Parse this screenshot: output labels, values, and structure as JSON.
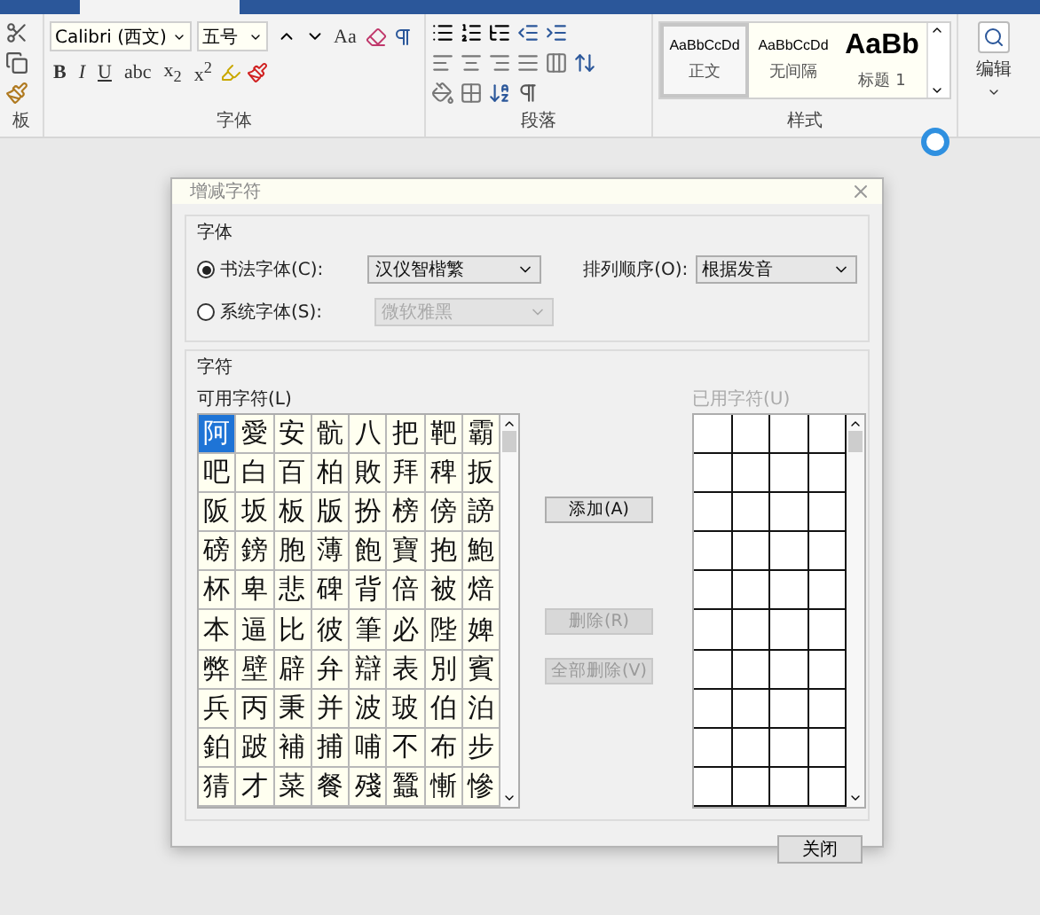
{
  "ribbon": {
    "clipboard_group": {
      "label": "板"
    },
    "font_group": {
      "label": "字体",
      "font_name": "Calibri (西文)",
      "font_size": "五号",
      "case_button": "Aa",
      "format_buttons": [
        "B",
        "I",
        "U",
        "abc",
        "x$_{2}$",
        "x$^{2}$"
      ]
    },
    "paragraph_group": {
      "label": "段落"
    },
    "styles_group": {
      "label": "样式",
      "styles": [
        {
          "sample": "AaBbCcDd",
          "name": "正文",
          "kind": "normal",
          "selected": true
        },
        {
          "sample": "AaBbCcDd",
          "name": "无间隔",
          "kind": "normal",
          "selected": false
        },
        {
          "sample": "AaBb",
          "name": "标题 1",
          "kind": "heading",
          "selected": false
        }
      ]
    },
    "editing_button": {
      "label": "编辑"
    }
  },
  "dialog": {
    "title": "增减字符",
    "font_section": {
      "label": "字体",
      "options": [
        {
          "label": "书法字体(C):",
          "value": "汉仪智楷繁",
          "selected": true,
          "disabled": false
        },
        {
          "label": "系统字体(S):",
          "value": "微软雅黑",
          "selected": false,
          "disabled": true
        }
      ],
      "sort": {
        "label": "排列顺序(O):",
        "value": "根据发音"
      }
    },
    "chars_section": {
      "label": "字符",
      "available": {
        "label": "可用字符(L)",
        "chars": [
          {
            "char": "阿",
            "selected": true
          },
          {
            "char": "愛",
            "selected": false
          },
          {
            "char": "安",
            "selected": false
          },
          {
            "char": "骯",
            "selected": false
          },
          {
            "char": "八",
            "selected": false
          },
          {
            "char": "把",
            "selected": false
          },
          {
            "char": "靶",
            "selected": false
          },
          {
            "char": "霸",
            "selected": false
          },
          {
            "char": "吧",
            "selected": false
          },
          {
            "char": "白",
            "selected": false
          },
          {
            "char": "百",
            "selected": false
          },
          {
            "char": "柏",
            "selected": false
          },
          {
            "char": "敗",
            "selected": false
          },
          {
            "char": "拜",
            "selected": false
          },
          {
            "char": "稗",
            "selected": false
          },
          {
            "char": "扳",
            "selected": false
          },
          {
            "char": "阪",
            "selected": false
          },
          {
            "char": "坂",
            "selected": false
          },
          {
            "char": "板",
            "selected": false
          },
          {
            "char": "版",
            "selected": false
          },
          {
            "char": "扮",
            "selected": false
          },
          {
            "char": "榜",
            "selected": false
          },
          {
            "char": "傍",
            "selected": false
          },
          {
            "char": "謗",
            "selected": false
          },
          {
            "char": "磅",
            "selected": false
          },
          {
            "char": "鎊",
            "selected": false
          },
          {
            "char": "胞",
            "selected": false
          },
          {
            "char": "薄",
            "selected": false
          },
          {
            "char": "飽",
            "selected": false
          },
          {
            "char": "寶",
            "selected": false
          },
          {
            "char": "抱",
            "selected": false
          },
          {
            "char": "鮑",
            "selected": false
          },
          {
            "char": "杯",
            "selected": false
          },
          {
            "char": "卑",
            "selected": false
          },
          {
            "char": "悲",
            "selected": false
          },
          {
            "char": "碑",
            "selected": false
          },
          {
            "char": "背",
            "selected": false
          },
          {
            "char": "倍",
            "selected": false
          },
          {
            "char": "被",
            "selected": false
          },
          {
            "char": "焙",
            "selected": false
          },
          {
            "char": "本",
            "selected": false
          },
          {
            "char": "逼",
            "selected": false
          },
          {
            "char": "比",
            "selected": false
          },
          {
            "char": "彼",
            "selected": false
          },
          {
            "char": "筆",
            "selected": false
          },
          {
            "char": "必",
            "selected": false
          },
          {
            "char": "陛",
            "selected": false
          },
          {
            "char": "婢",
            "selected": false
          },
          {
            "char": "弊",
            "selected": false
          },
          {
            "char": "壁",
            "selected": false
          },
          {
            "char": "辟",
            "selected": false
          },
          {
            "char": "弁",
            "selected": false
          },
          {
            "char": "辯",
            "selected": false
          },
          {
            "char": "表",
            "selected": false
          },
          {
            "char": "別",
            "selected": false
          },
          {
            "char": "賓",
            "selected": false
          },
          {
            "char": "兵",
            "selected": false
          },
          {
            "char": "丙",
            "selected": false
          },
          {
            "char": "秉",
            "selected": false
          },
          {
            "char": "并",
            "selected": false
          },
          {
            "char": "波",
            "selected": false
          },
          {
            "char": "玻",
            "selected": false
          },
          {
            "char": "伯",
            "selected": false
          },
          {
            "char": "泊",
            "selected": false
          },
          {
            "char": "鉑",
            "selected": false
          },
          {
            "char": "跛",
            "selected": false
          },
          {
            "char": "補",
            "selected": false
          },
          {
            "char": "捕",
            "selected": false
          },
          {
            "char": "哺",
            "selected": false
          },
          {
            "char": "不",
            "selected": false
          },
          {
            "char": "布",
            "selected": false
          },
          {
            "char": "步",
            "selected": false
          },
          {
            "char": "猜",
            "selected": false
          },
          {
            "char": "才",
            "selected": false
          },
          {
            "char": "菜",
            "selected": false
          },
          {
            "char": "餐",
            "selected": false
          },
          {
            "char": "殘",
            "selected": false
          },
          {
            "char": "蠶",
            "selected": false
          },
          {
            "char": "慚",
            "selected": false
          },
          {
            "char": "慘",
            "selected": false
          }
        ]
      },
      "buttons": [
        {
          "label": "添加(A)",
          "disabled": false
        },
        {
          "label": "删除(R)",
          "disabled": true
        },
        {
          "label": "全部删除(V)",
          "disabled": true
        }
      ],
      "used": {
        "label": "已用字符(U)",
        "disabled": true
      }
    },
    "close_button": "关闭"
  }
}
